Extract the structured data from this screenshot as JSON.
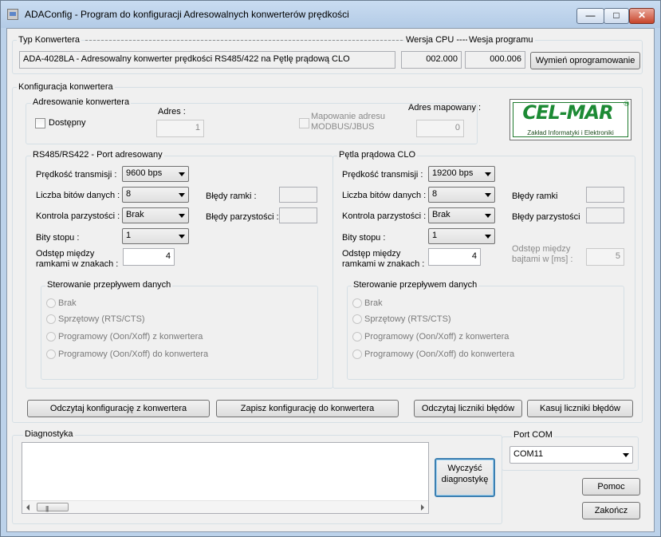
{
  "window": {
    "title": "ADAConfig - Program do konfiguracji Adresowalnych konwerterów prędkości"
  },
  "colors": {
    "accent": "#3c7fb1",
    "logo_green": "#1c8a34",
    "close": "#c7452b"
  },
  "type_section": {
    "label": "Typ Konwertera",
    "device": "ADA-4028LA -  Adresowalny konwerter prędkości RS485/422 na Pętlę prądową CLO",
    "cpu_label": "Wersja CPU ----",
    "cpu_value": "002.000",
    "prog_label": "Wesja programu",
    "prog_value": "000.006",
    "update_button": "Wymień oprogramowanie"
  },
  "config": {
    "label": "Konfiguracja konwertera",
    "addressing": {
      "label": "Adresowanie konwertera",
      "available": "Dostępny",
      "address_label": "Adres :",
      "address_value": "1",
      "mapping_label_1": "Mapowanie adresu",
      "mapping_label_2": "MODBUS/JBUS",
      "mapped_label": "Adres mapowany :",
      "mapped_value": "0"
    },
    "logo": {
      "brand": "CEL-MAR",
      "reg": "®",
      "tagline": "Zakład Informatyki i Elektroniki"
    },
    "rs485": {
      "label": "RS485/RS422 - Port adresowany",
      "speed_label": "Prędkość transmisji :",
      "speed_value": "9600 bps",
      "bits_label": "Liczba bitów danych :",
      "bits_value": "8",
      "parity_label": "Kontrola parzystości :",
      "parity_value": "Brak",
      "stop_label": "Bity stopu :",
      "stop_value": "1",
      "gap_label_1": "Odstęp między",
      "gap_label_2": "ramkami w znakach  :",
      "gap_value": "4",
      "frame_err_label": "Błędy ramki :",
      "parity_err_label": "Błędy parzystości :",
      "flow_label": "Sterowanie przepływem danych",
      "flow_options": [
        "Brak",
        "Sprzętowy (RTS/CTS)",
        "Programowy (Oon/Xoff) z konwertera",
        "Programowy (Oon/Xoff) do konwertera"
      ]
    },
    "clo": {
      "label": "Pętla prądowa CLO",
      "speed_label": "Prędkość transmisji :",
      "speed_value": "19200 bps",
      "bits_label": "Liczba bitów danych :",
      "bits_value": "8",
      "parity_label": "Kontrola parzystości :",
      "parity_value": "Brak",
      "stop_label": "Bity stopu :",
      "stop_value": "1",
      "gap_label_1": "Odstęp między",
      "gap_label_2": "ramkami w znakach  :",
      "gap_value": "4",
      "frame_err_label": "Błędy ramki",
      "parity_err_label": "Błędy parzystości",
      "byte_gap_label_1": "Odstęp między",
      "byte_gap_label_2": "bajtami w [ms] :",
      "byte_gap_value": "5",
      "flow_label": "Sterowanie przepływem danych",
      "flow_options": [
        "Brak",
        "Sprzętowy (RTS/CTS)",
        "Programowy (Oon/Xoff) z konwertera",
        "Programowy (Oon/Xoff) do konwertera"
      ]
    },
    "buttons": {
      "read_config": "Odczytaj konfigurację z konwertera",
      "write_config": "Zapisz konfigurację do konwertera",
      "read_counters": "Odczytaj liczniki błędów",
      "reset_counters": "Kasuj liczniki błędów"
    }
  },
  "diagnostics": {
    "label": "Diagnostyka",
    "clear_line1": "Wyczyść",
    "clear_line2": "diagnostykę"
  },
  "port": {
    "label": "Port COM",
    "value": "COM11"
  },
  "footer": {
    "help": "Pomoc",
    "exit": "Zakończ"
  }
}
